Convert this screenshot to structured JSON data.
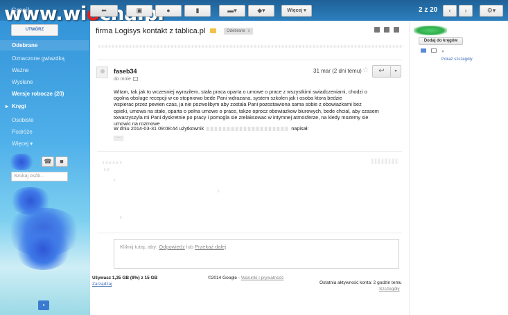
{
  "watermark": {
    "prefix": "www.wi",
    "o": "o",
    "suffix": "cha.pl"
  },
  "app": {
    "name": "Gmail"
  },
  "toolbar": {
    "more_label": "Więcej",
    "page_indicator": "2 z 20"
  },
  "sidebar": {
    "compose_label": "UTWÓRZ",
    "items": [
      {
        "label": "Odebrane",
        "bold": true
      },
      {
        "label": "Oznaczone gwiazdką",
        "bold": false
      },
      {
        "label": "Ważne",
        "bold": false
      },
      {
        "label": "Wysłane",
        "bold": false
      },
      {
        "label": "Wersje robocze (20)",
        "bold": true
      },
      {
        "label": "Kręgi",
        "bold": true
      },
      {
        "label": "Osobiste",
        "bold": false
      },
      {
        "label": "Podróże",
        "bold": false
      },
      {
        "label": "Więcej",
        "bold": false
      }
    ],
    "search_people_placeholder": "Szukaj osób..."
  },
  "message": {
    "subject": "firma Logisys kontakt z tablica.pl",
    "label": "Odebrane",
    "label_close": "x",
    "sender": "faseb34",
    "to": "do mnie",
    "date": "31 mar (2 dni temu)",
    "star": "☆",
    "reply_icon": "↩",
    "more_icon": "▾",
    "body_lines": [
      "Witam, tak jak to wczesniej wyrazilem, stała praca oparta o umowe o prace z wszystkimi swiadczeniami, chodzi o",
      "ogolna obsluge recepcji w co stopniowo bede Pani wdrazana, system szkolen jak i osoba ktora bedzie",
      "wspierac przez pewien czas, ja nie pozwolibym aby zostala Pani  pozostawiona sama sobie z obowiazkami bez",
      "opieki, umowa na stałe, oparta o pełna umowe o prace, takze oprocz obowiazkow biurowych, bede chcial, aby czasem",
      "towarzyszyla mi Pani dyskretnie po pracy i pomogla sie zrelaksowac w intymnej atmosferze, na kiedy mozemy sie",
      "umowic na rozmowe"
    ],
    "quote_prefix": "W dniu 2014-03-31 09:08:44 użytkownik",
    "quote_suffix": "napisał:",
    "ellipsis": "···"
  },
  "reply_box": {
    "prefix": "Kliknij tutaj, aby:",
    "reply_link": "Odpowiedz",
    "or": "lub",
    "forward_link": "Przekaż dalej"
  },
  "footer": {
    "usage": "Używasz 1,35 GB (8%) z 15 GB",
    "manage": "Zarządzaj",
    "copyright": "©2014 Google -",
    "terms": "Warunki i prywatność",
    "activity": "Ostatnia aktywność konta: 2 godzin temu",
    "details": "Szczegóły"
  },
  "contact": {
    "add_circles": "Dodaj do kręgów",
    "show_details": "Pokaż szczegóły"
  },
  "colors": {
    "link": "#3b6cb7",
    "background_sky": "#4fb0ea",
    "watermark_accent": "#e02020"
  }
}
